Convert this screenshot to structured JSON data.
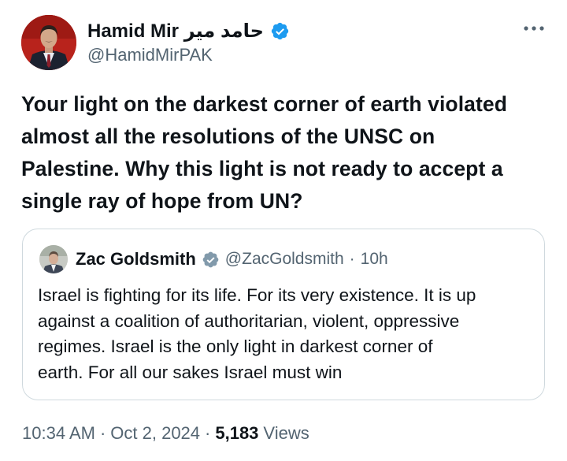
{
  "tweet": {
    "author": {
      "name": "Hamid Mir حامد میر",
      "handle": "@HamidMirPAK",
      "avatar_icon": "person-portrait-icon",
      "verified_icon": "verified-badge-icon",
      "verified_color": "#1d9bf0"
    },
    "more_icon": "more-options-icon",
    "text_lines": [
      "Your light on the darkest corner of earth violated",
      "almost all the resolutions of the UNSC on",
      "Palestine. Why this light is not ready to accept a",
      "single ray of hope from UN?"
    ],
    "quote": {
      "name": "Zac Goldsmith",
      "verified_icon": "verified-badge-grey-icon",
      "verified_color": "#829aab",
      "handle": "@ZacGoldsmith",
      "separator": "·",
      "time": "10h",
      "text_lines": [
        "Israel is fighting for its life. For its very existence. It is up",
        "against a coalition of authoritarian, violent, oppressive",
        "regimes. Israel is the only light in darkest corner of",
        "earth. For all our sakes Israel must win"
      ]
    },
    "meta": {
      "time": "10:34 AM",
      "separator1": "·",
      "date": "Oct 2, 2024",
      "separator2": "·",
      "views_count": "5,183",
      "views_label": "Views"
    }
  }
}
